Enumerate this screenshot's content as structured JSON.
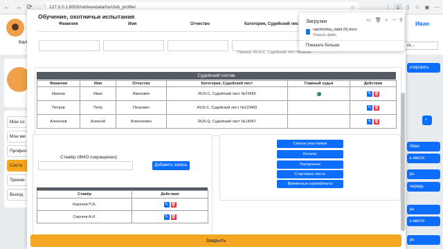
{
  "browser": {
    "url": "127.0.0.1:8000/retrievedata/hx/club_profile/"
  },
  "background": {
    "kal_label": "Кал",
    "user_name": "Иван",
    "side_items": [
      "Мои со",
      "Мои ме",
      "Профил",
      "Соста",
      "Тренин",
      "Выход"
    ],
    "right_buttons": [
      "ктировать",
      "+",
      "Иван",
      "ь место",
      "рь",
      "нередь",
      "рь",
      "ь место",
      "рь"
    ],
    "right_input": "ск..."
  },
  "modal": {
    "title": "Обучение, охотничьи испытания",
    "top_headers": [
      "Фамилия",
      "Имя",
      "Отчество",
      "Категория, Судейский лист"
    ],
    "hint": "Пример: RUS-C, Судейский лист №00000",
    "jury": {
      "title": "Судейский состав",
      "headers": [
        "Фамилия",
        "Имя",
        "Отчество",
        "Категория, Судейский лист",
        "Главный судья",
        "Действия"
      ],
      "rows": [
        [
          "Иванов",
          "Иван",
          "Иванович",
          "RUS-C, Судейский лист №23455"
        ],
        [
          "Петров",
          "Петр",
          "Петрович",
          "RUS-C, Судейский лист №123409"
        ],
        [
          "Алексеев",
          "Алексей",
          "Алексеевич",
          "RUS-Q, Судейский лист №14567"
        ]
      ]
    },
    "trainee": {
      "label": "Стажёр (ФИО сокращенно)",
      "add_button": "Добавить запись",
      "headers": [
        "Стажёр",
        "Действия"
      ],
      "rows": [
        "Королев П.А.",
        "Сергеев А.И."
      ]
    },
    "links": [
      "Список участников",
      "Каталог",
      "Рапортичка",
      "Стартовые листы",
      "Временные сертификаты"
    ],
    "close_button": "Закрыть"
  },
  "downloads": {
    "title": "Загрузки",
    "file_name": "raportichka_ripbd (6).docx",
    "file_status": "Открыть файл",
    "show_more": "Показать больше"
  }
}
